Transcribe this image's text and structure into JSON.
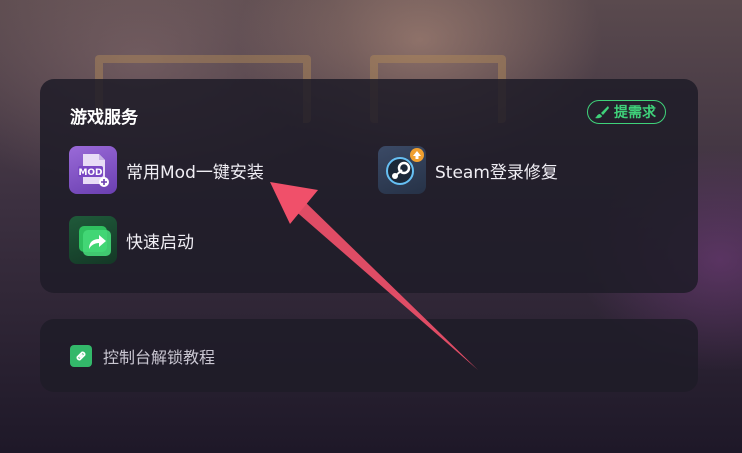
{
  "services": {
    "title": "游戏服务",
    "request_label": "提需求",
    "items": [
      {
        "label": "常用Mod一键安装",
        "icon": "mod-icon"
      },
      {
        "label": "Steam登录修复",
        "icon": "steam-icon"
      },
      {
        "label": "快速启动",
        "icon": "quick-launch-icon"
      }
    ],
    "mod_icon_text": "MOD"
  },
  "tutorial": {
    "label": "控制台解锁教程",
    "icon": "link-icon"
  },
  "colors": {
    "accent_green": "#3fd27a",
    "card_bg": "#1e1c28",
    "annotation_arrow": "#f0506a"
  }
}
